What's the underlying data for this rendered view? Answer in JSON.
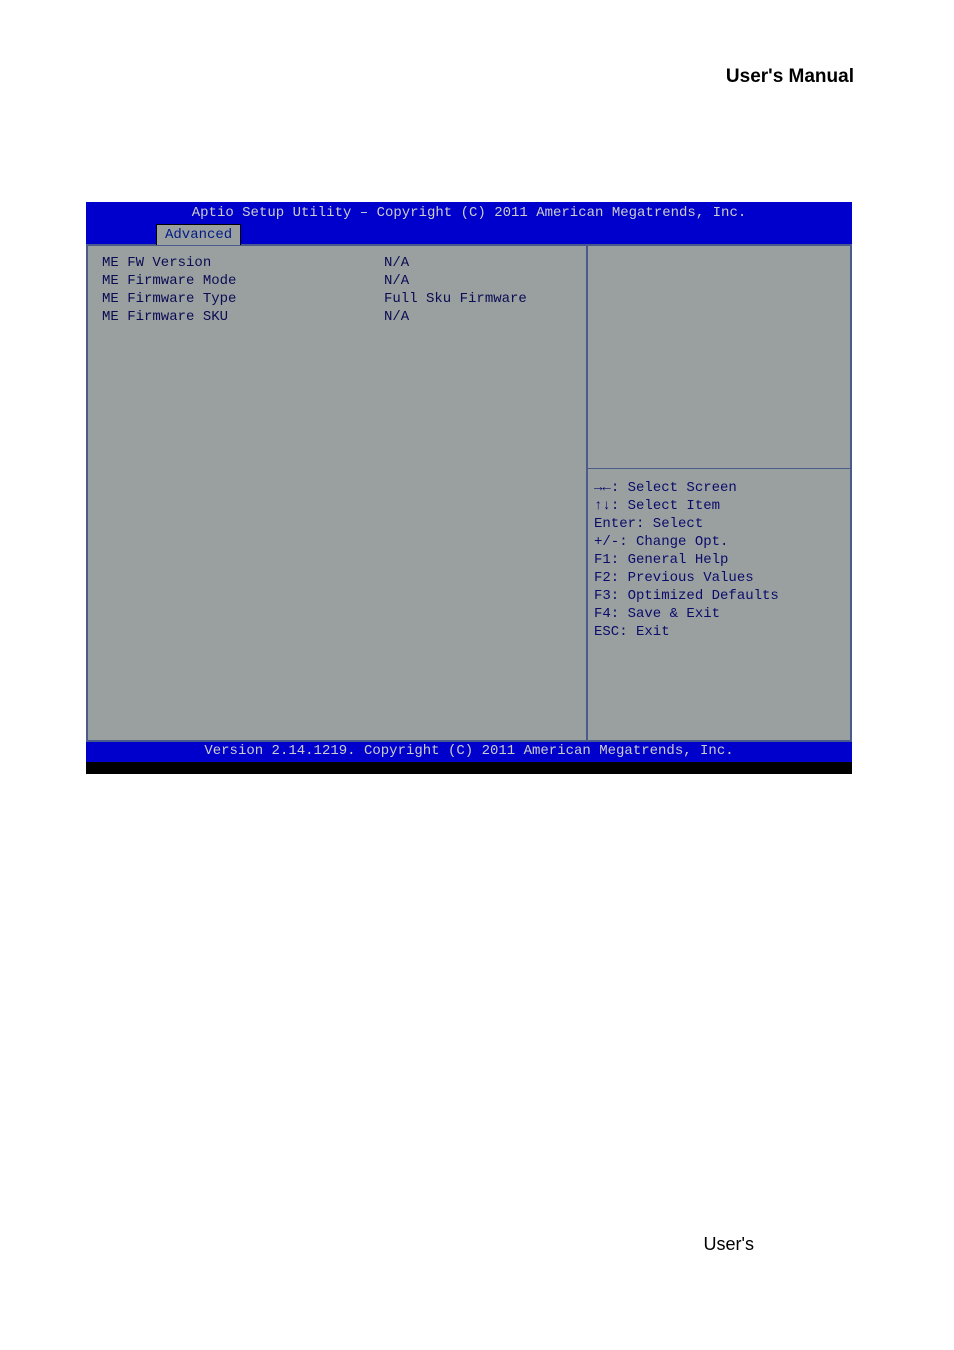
{
  "page": {
    "header": "User's  Manual",
    "footer": "User's"
  },
  "bios": {
    "title": "Aptio Setup Utility – Copyright (C) 2011 American Megatrends, Inc.",
    "tab": "Advanced",
    "footer": "Version 2.14.1219. Copyright (C) 2011 American Megatrends, Inc.",
    "items": [
      {
        "label": "ME FW Version",
        "value": "N/A"
      },
      {
        "label": "ME Firmware Mode",
        "value": "N/A"
      },
      {
        "label": "ME Firmware Type",
        "value": "Full Sku Firmware"
      },
      {
        "label": "ME Firmware SKU",
        "value": "N/A"
      }
    ],
    "help": {
      "select_screen": ": Select Screen",
      "select_item": ": Select Item",
      "enter": "Enter: Select",
      "change_opt": "+/-: Change Opt.",
      "f1": "F1: General Help",
      "f2": "F2: Previous Values",
      "f3": "F3: Optimized Defaults",
      "f4": "F4: Save & Exit",
      "esc": "ESC: Exit"
    }
  }
}
